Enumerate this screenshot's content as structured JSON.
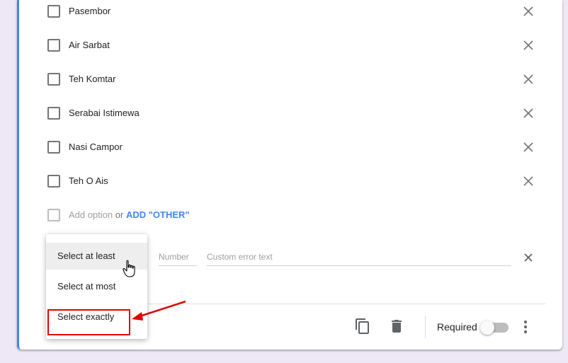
{
  "options": [
    {
      "label": "Pasembor"
    },
    {
      "label": "Air Sarbat"
    },
    {
      "label": "Teh Komtar"
    },
    {
      "label": "Serabai Istimewa"
    },
    {
      "label": "Nasi Campor"
    },
    {
      "label": "Teh O Ais"
    }
  ],
  "add_option": {
    "text": "Add option",
    "or": "or",
    "other_link": "ADD \"OTHER\""
  },
  "validation": {
    "number_placeholder": "Number",
    "error_placeholder": "Custom error text"
  },
  "dropdown": {
    "items": [
      {
        "label": "Select at least"
      },
      {
        "label": "Select at most"
      },
      {
        "label": "Select exactly"
      }
    ],
    "hovered_index": 0
  },
  "footer": {
    "required_label": "Required",
    "required_on": false
  },
  "icons": {
    "remove": "close-icon",
    "duplicate": "copy-icon",
    "delete": "trash-icon",
    "more": "more-vertical-icon"
  },
  "colors": {
    "accent": "#4285f4",
    "annotation": "#e00000",
    "background": "#ede7f6"
  }
}
